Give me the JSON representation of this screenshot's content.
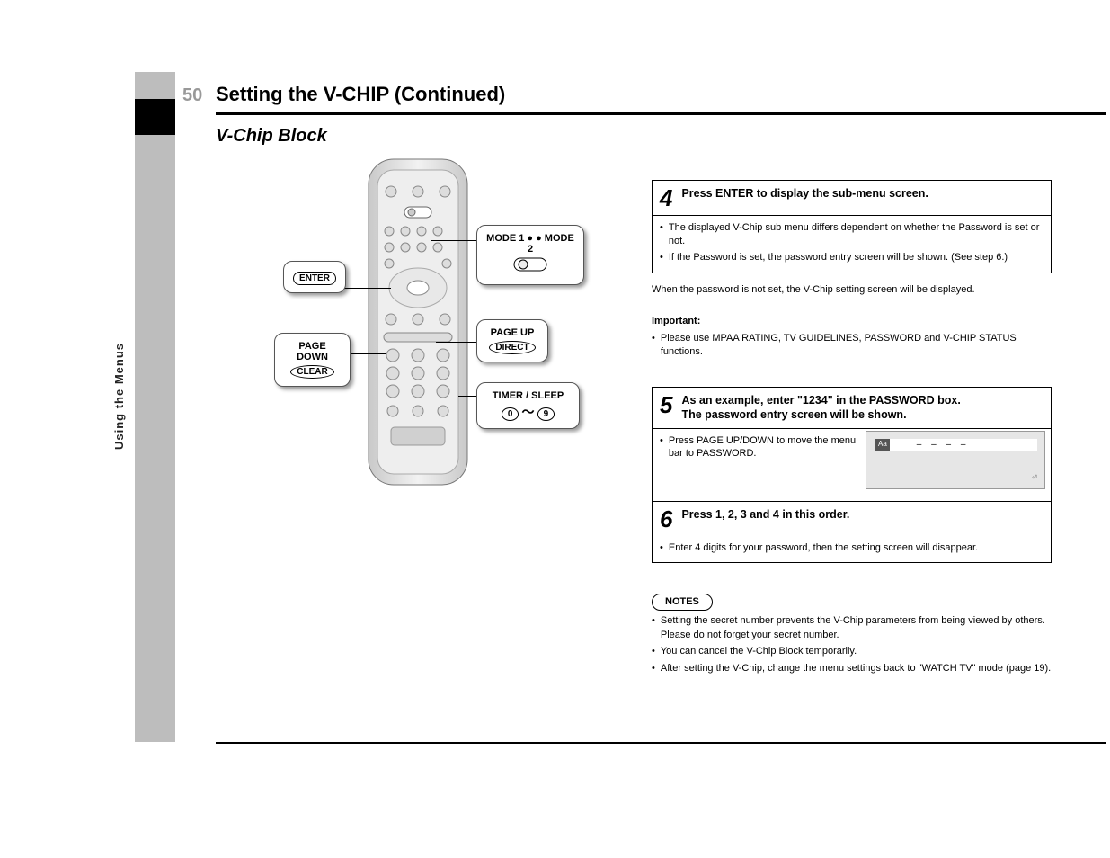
{
  "page_number": "50",
  "title": "Setting the V-CHIP (Continued)",
  "side_tab": "Using the Menus",
  "subtitle": "V-Chip Block",
  "remote": {
    "callout_enter": "ENTER",
    "callout_pagedown_title": "PAGE DOWN",
    "callout_pagedown_btn": "CLEAR",
    "callout_pageup_title": "PAGE UP",
    "callout_pageup_btn": "DIRECT",
    "callout_timersleep_title": "TIMER / SLEEP",
    "callout_timersleep_range": "0  ～  9",
    "callout_mode": "MODE 1 ●    ● MODE 2"
  },
  "step4": {
    "num": "4",
    "title": "Press ENTER to display the sub-menu screen.",
    "body": [
      "The displayed V-Chip sub menu differs dependent on whether the Password is set or not.",
      "If the Password is set, the password entry screen will be shown. (See step 6.)"
    ]
  },
  "intertext": "When the password is not set, the V-Chip setting screen will be displayed.",
  "important_label": "Important:",
  "important_items": [
    "Please use MPAA RATING, TV GUIDELINES, PASSWORD and V-CHIP STATUS functions."
  ],
  "step5": {
    "num": "5",
    "title_line1": "As an example, enter \"1234\" in the PASSWORD box.",
    "title_line2": "The password entry screen will be shown.",
    "body": "Press PAGE UP/DOWN to move the menu bar to PASSWORD.",
    "screen_label": "Aa",
    "screen_dashes": "– – – –",
    "screen_hint": "⏎"
  },
  "step6": {
    "num": "6",
    "title": "Press 1, 2, 3 and 4 in this order.",
    "body": "Enter 4 digits for your password, then the setting screen will disappear."
  },
  "notes": {
    "caption": "NOTES",
    "items": [
      "Setting the secret number prevents the V-Chip parameters from being viewed by others. Please do not forget your secret number.",
      "You can cancel the V-Chip Block temporarily.",
      "After setting the V-Chip, change the menu settings back to \"WATCH TV\" mode (page 19)."
    ]
  }
}
